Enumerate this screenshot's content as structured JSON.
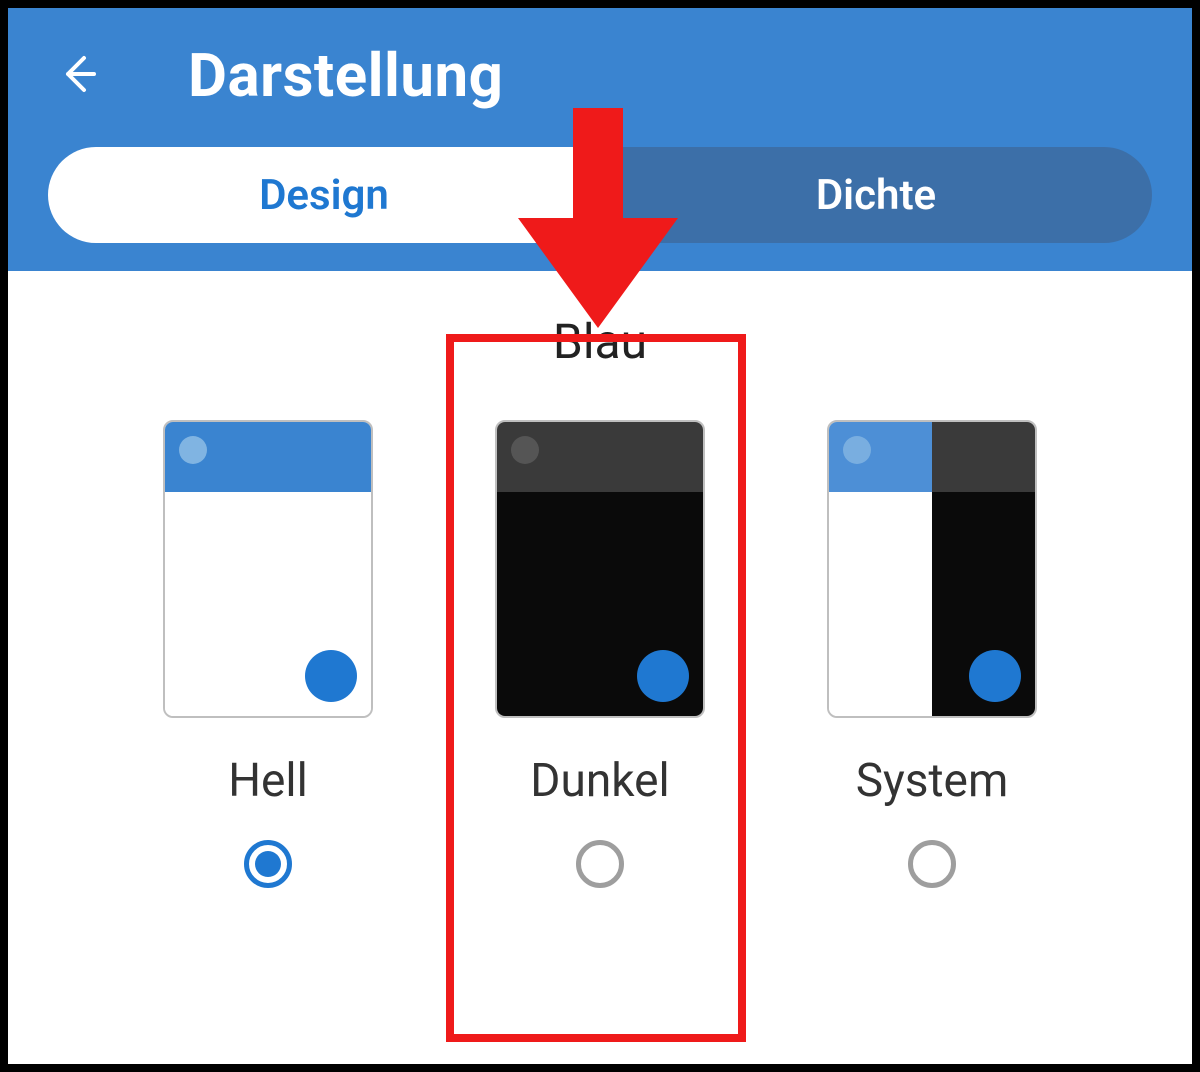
{
  "header": {
    "title": "Darstellung"
  },
  "tabs": {
    "design": "Design",
    "density": "Dichte",
    "active": "design"
  },
  "theme_section": {
    "label": "Blau",
    "options": [
      {
        "id": "hell",
        "label": "Hell",
        "selected": true
      },
      {
        "id": "dunkel",
        "label": "Dunkel",
        "selected": false
      },
      {
        "id": "system",
        "label": "System",
        "selected": false
      }
    ]
  },
  "annotation": {
    "target_option": "dunkel"
  }
}
